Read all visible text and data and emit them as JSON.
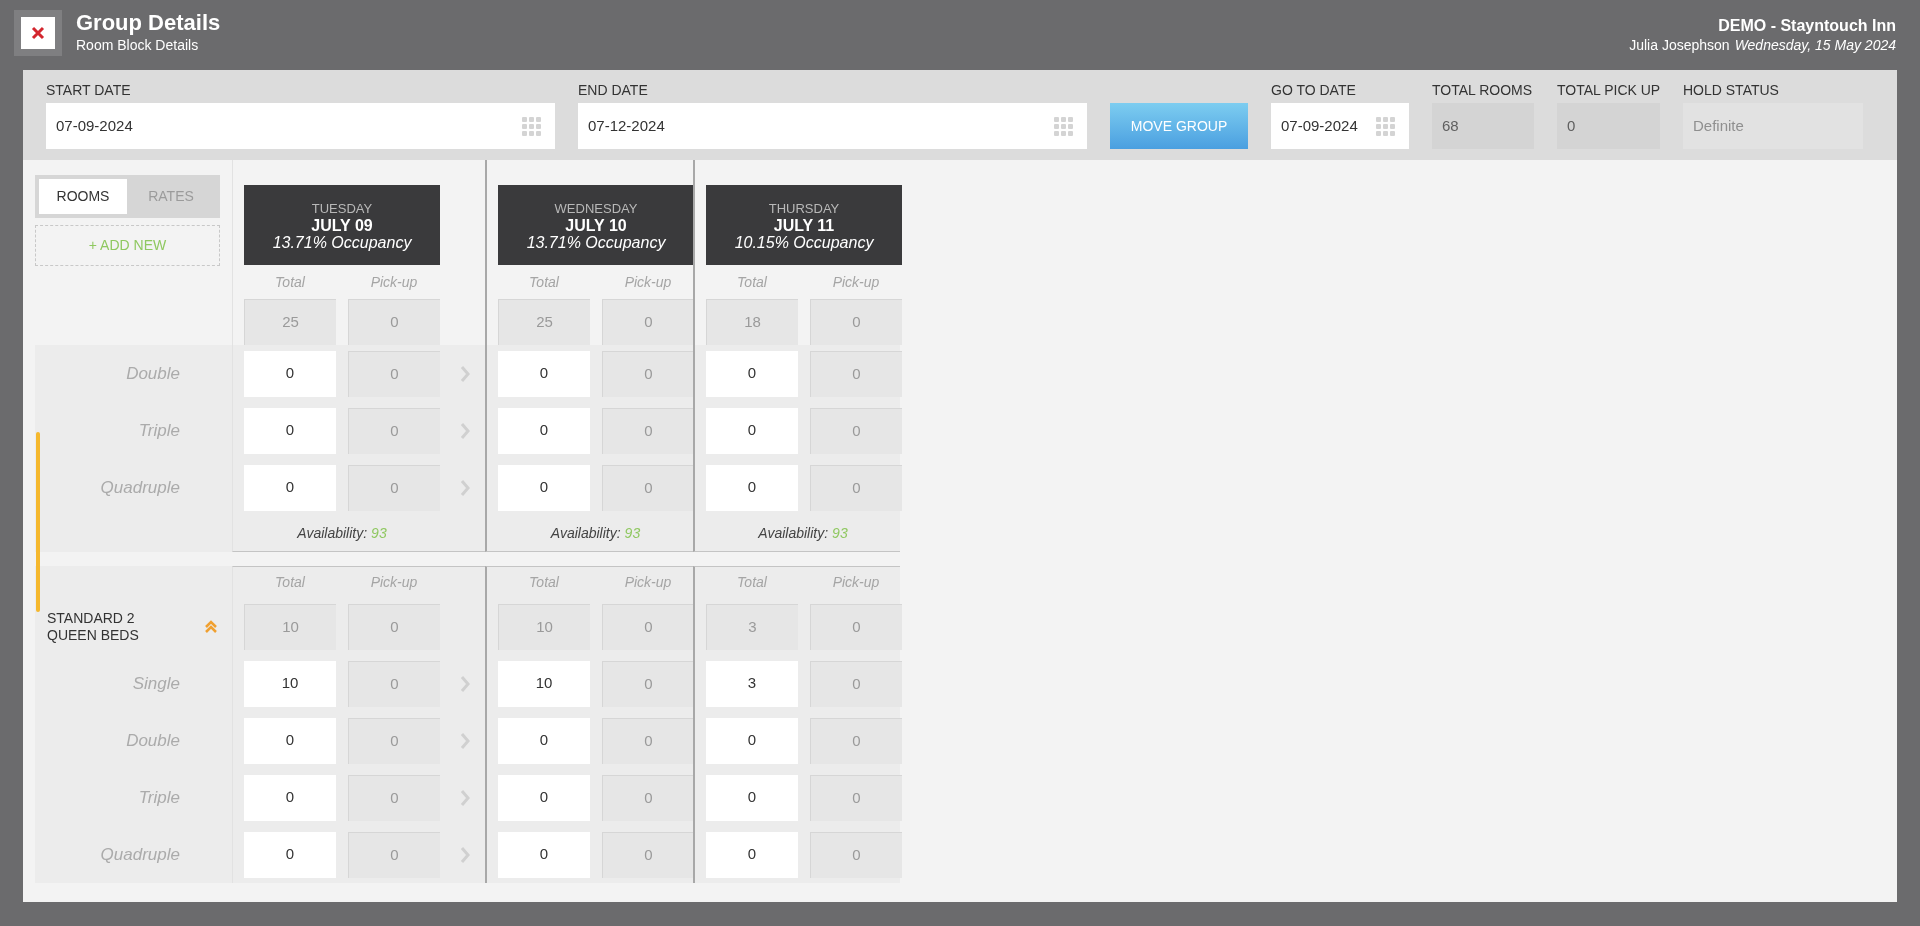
{
  "header": {
    "title": "Group Details",
    "subtitle": "Room Block Details",
    "property": "DEMO - Stayntouch Inn",
    "user": "Julia Josephson",
    "date": "Wednesday, 15 May 2024"
  },
  "filters": [
    {
      "kind": "date",
      "label": "START DATE",
      "value": "07-09-2024",
      "disabled": false
    },
    {
      "kind": "date",
      "label": "END DATE",
      "value": "07-12-2024",
      "disabled": false
    },
    {
      "kind": "button",
      "label": "MOVE GROUP",
      "disabled": false
    },
    {
      "kind": "date",
      "label": "GO TO DATE",
      "value": "07-09-2024",
      "disabled": false
    },
    {
      "kind": "readonly",
      "label": "TOTAL ROOMS",
      "value": "68",
      "disabled": false
    },
    {
      "kind": "readonly",
      "label": "TOTAL PICK UP",
      "value": "0",
      "disabled": false
    },
    {
      "kind": "readonly",
      "label": "HOLD STATUS",
      "value": "Definite",
      "disabled": true
    }
  ],
  "tabs": [
    {
      "label": "ROOMS",
      "selected": true
    },
    {
      "label": "RATES",
      "selected": false
    }
  ],
  "add_new": "+ ADD NEW",
  "days": [
    {
      "weekday": "TUESDAY",
      "date": "JULY 09",
      "occupancy": "13.71% Occupancy",
      "total_label": "Total",
      "pickup_label": "Pick-up",
      "total": "25",
      "pickup": "0",
      "copy_arrow": true
    },
    {
      "weekday": "WEDNESDAY",
      "date": "JULY 10",
      "occupancy": "13.71% Occupancy",
      "total_label": "Total",
      "pickup_label": "Pick-up",
      "total": "25",
      "pickup": "0",
      "copy_arrow": false
    },
    {
      "weekday": "THURSDAY",
      "date": "JULY 11",
      "occupancy": "10.15% Occupancy",
      "total_label": "Total",
      "pickup_label": "Pick-up",
      "total": "18",
      "pickup": "0",
      "copy_arrow": false
    }
  ],
  "sections": [
    {
      "rows": [
        {
          "label": "Double",
          "cells": [
            {
              "total": "0",
              "pickup": "0"
            },
            {
              "total": "0",
              "pickup": "0"
            },
            {
              "total": "0",
              "pickup": "0"
            }
          ]
        },
        {
          "label": "Triple",
          "cells": [
            {
              "total": "0",
              "pickup": "0"
            },
            {
              "total": "0",
              "pickup": "0"
            },
            {
              "total": "0",
              "pickup": "0"
            }
          ]
        },
        {
          "label": "Quadruple",
          "cells": [
            {
              "total": "0",
              "pickup": "0"
            },
            {
              "total": "0",
              "pickup": "0"
            },
            {
              "total": "0",
              "pickup": "0"
            }
          ]
        }
      ],
      "availability": [
        {
          "label": "Availability:",
          "value": "93"
        },
        {
          "label": "Availability:",
          "value": "93"
        },
        {
          "label": "Availability:",
          "value": "93"
        }
      ]
    },
    {
      "name": "STANDARD 2 QUEEN BEDS",
      "expanded": true,
      "headers": [
        {
          "total_label": "Total",
          "pickup_label": "Pick-up",
          "total": "10",
          "pickup": "0"
        },
        {
          "total_label": "Total",
          "pickup_label": "Pick-up",
          "total": "10",
          "pickup": "0"
        },
        {
          "total_label": "Total",
          "pickup_label": "Pick-up",
          "total": "3",
          "pickup": "0"
        }
      ],
      "rows": [
        {
          "label": "Single",
          "cells": [
            {
              "total": "10",
              "pickup": "0"
            },
            {
              "total": "10",
              "pickup": "0"
            },
            {
              "total": "3",
              "pickup": "0"
            }
          ]
        },
        {
          "label": "Double",
          "cells": [
            {
              "total": "0",
              "pickup": "0"
            },
            {
              "total": "0",
              "pickup": "0"
            },
            {
              "total": "0",
              "pickup": "0"
            }
          ]
        },
        {
          "label": "Triple",
          "cells": [
            {
              "total": "0",
              "pickup": "0"
            },
            {
              "total": "0",
              "pickup": "0"
            },
            {
              "total": "0",
              "pickup": "0"
            }
          ]
        },
        {
          "label": "Quadruple",
          "cells": [
            {
              "total": "0",
              "pickup": "0"
            },
            {
              "total": "0",
              "pickup": "0"
            },
            {
              "total": "0",
              "pickup": "0"
            }
          ]
        }
      ]
    }
  ]
}
